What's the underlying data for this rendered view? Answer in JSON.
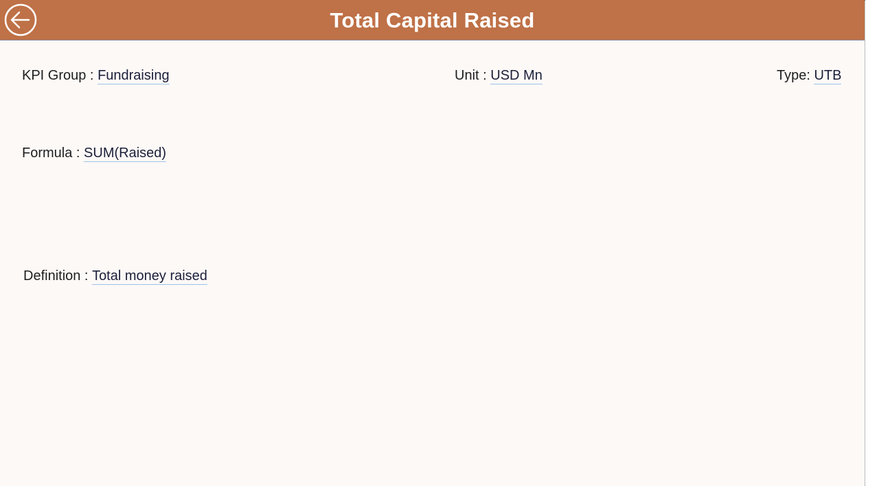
{
  "header": {
    "title": "Total Capital Raised",
    "back_icon": "arrow-left-circle-icon",
    "background_color": "#bf7147",
    "title_color": "#ffffff"
  },
  "fields": {
    "kpi_group": {
      "label": "KPI Group :",
      "value": "Fundraising"
    },
    "unit": {
      "label": "Unit :",
      "value": "USD Mn"
    },
    "type": {
      "label": "Type:",
      "value": "UTB"
    },
    "formula": {
      "label": "Formula :",
      "value": "SUM(Raised)"
    },
    "definition": {
      "label": "Definition :",
      "value": "Total money raised"
    }
  },
  "colors": {
    "page_background": "#fdf9f7",
    "value_underline": "#9ec3e6"
  }
}
